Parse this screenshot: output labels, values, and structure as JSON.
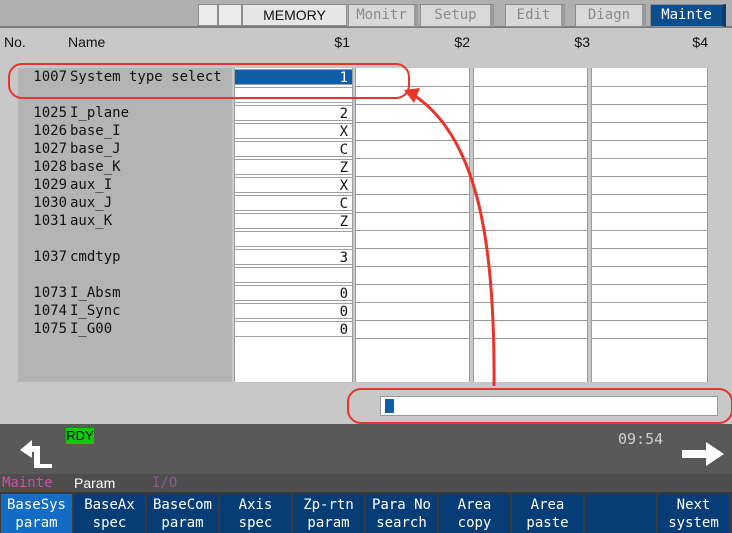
{
  "tabs": {
    "memory": "MEMORY",
    "items": [
      "Monitr",
      "Setup",
      "Edit",
      "Diagn",
      "Mainte"
    ],
    "active_index": 4
  },
  "header": {
    "no": "No.",
    "name": "Name",
    "cols": [
      "$1",
      "$2",
      "$3",
      "$4"
    ]
  },
  "rows": [
    {
      "no": "1007",
      "name": "System type select",
      "val": "1",
      "selected": true
    },
    {
      "no": "",
      "name": "",
      "val": ""
    },
    {
      "no": "1025",
      "name": "I_plane",
      "val": "2"
    },
    {
      "no": "1026",
      "name": "base_I",
      "val": "X"
    },
    {
      "no": "1027",
      "name": "base_J",
      "val": "C"
    },
    {
      "no": "1028",
      "name": "base_K",
      "val": "Z"
    },
    {
      "no": "1029",
      "name": "aux_I",
      "val": "X"
    },
    {
      "no": "1030",
      "name": "aux_J",
      "val": "C"
    },
    {
      "no": "1031",
      "name": "aux_K",
      "val": "Z"
    },
    {
      "no": "",
      "name": "",
      "val": ""
    },
    {
      "no": "1037",
      "name": "cmdtyp",
      "val": "3"
    },
    {
      "no": "",
      "name": "",
      "val": ""
    },
    {
      "no": "1073",
      "name": "I_Absm",
      "val": "0"
    },
    {
      "no": "1074",
      "name": "I_Sync",
      "val": "0"
    },
    {
      "no": "1075",
      "name": "I_G00",
      "val": "0"
    }
  ],
  "input": {
    "value": ""
  },
  "status": {
    "ready": "RDY",
    "time": "09:54"
  },
  "menu": {
    "items": [
      "Mainte",
      "Param",
      "I/O"
    ]
  },
  "softkeys": [
    [
      "BaseSys",
      "param"
    ],
    [
      "BaseAx",
      "spec"
    ],
    [
      "BaseCom",
      "param"
    ],
    [
      "Axis",
      "spec"
    ],
    [
      "Zp-rtn",
      "param"
    ],
    [
      "Para No",
      "search"
    ],
    [
      "Area",
      "copy"
    ],
    [
      "Area",
      "paste"
    ],
    [
      "",
      ""
    ],
    [
      "Next",
      "system"
    ]
  ],
  "colors": {
    "accent": "#0f5fa8",
    "annotation": "#e8342a",
    "ready": "#11c811"
  }
}
